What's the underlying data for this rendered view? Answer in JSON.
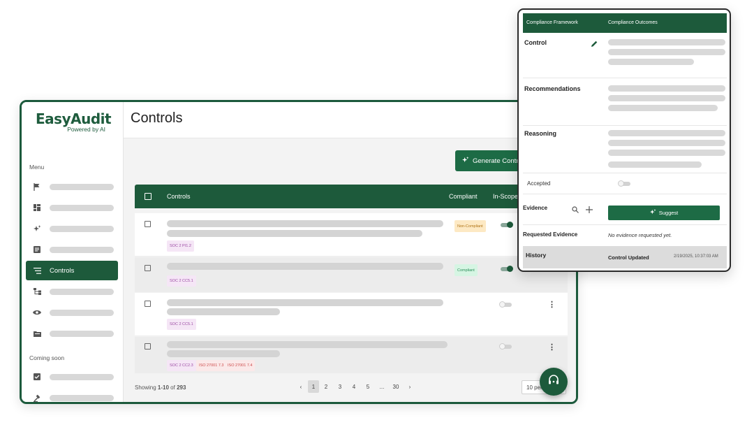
{
  "brand": {
    "name": "EasyAudit",
    "tagline": "Powered by AI",
    "primary_color": "#1d5a3b"
  },
  "sidebar": {
    "menu_label": "Menu",
    "coming_soon_label": "Coming soon",
    "items": [
      {
        "icon": "flag-icon"
      },
      {
        "icon": "dashboard-icon"
      },
      {
        "icon": "sparkle-icon"
      },
      {
        "icon": "document-icon"
      },
      {
        "icon": "list-icon",
        "label": "Controls",
        "active": true
      },
      {
        "icon": "hierarchy-icon"
      },
      {
        "icon": "eye-icon"
      },
      {
        "icon": "folder-icon"
      }
    ],
    "coming_soon_items": [
      {
        "icon": "checkbox-icon"
      },
      {
        "icon": "gavel-icon"
      }
    ]
  },
  "page": {
    "title": "Controls"
  },
  "toolbar": {
    "generate_label": "Generate Contr"
  },
  "table": {
    "columns": {
      "controls": "Controls",
      "compliant": "Compliant",
      "in_scope": "In-Scope"
    },
    "rows": [
      {
        "tags": [
          "SOC 2 PI1.2"
        ],
        "compliance": "Non-Compliant",
        "in_scope": true,
        "actions": false
      },
      {
        "tags": [
          "SOC 2 CC5.1"
        ],
        "compliance": "Compliant",
        "in_scope": true,
        "actions": false
      },
      {
        "tags": [
          "SOC 2 CC5.1"
        ],
        "compliance": "",
        "in_scope": false,
        "actions": true
      },
      {
        "tags": [
          "SOC 2 CC2.3",
          "ISO 27001 7.3",
          "ISO 27001 7.4"
        ],
        "compliance": "",
        "in_scope": false,
        "actions": true
      }
    ]
  },
  "pagination": {
    "showing_prefix": "Showing ",
    "range": "1-10",
    "of_text": " of ",
    "total": "293",
    "prev": "‹",
    "next": "›",
    "pages": [
      "1",
      "2",
      "3",
      "4",
      "5",
      "...",
      "30"
    ],
    "current": "1",
    "per_page": "10 per"
  },
  "panel": {
    "tabs": {
      "framework": "Compliance Framework",
      "outcomes": "Compliance Outcomes"
    },
    "control_label": "Control",
    "recommendations_label": "Recommendations",
    "reasoning_label": "Reasoning",
    "accepted_label": "Accepted",
    "accepted": false,
    "evidence_label": "Evidence",
    "suggest_label": "Suggest",
    "requested_evidence_label": "Requested Evidence",
    "requested_evidence_value": "No evidence requested yet.",
    "history_label": "History",
    "history_event": "Control Updated",
    "history_time": "2/19/2025, 10:37:03 AM"
  }
}
